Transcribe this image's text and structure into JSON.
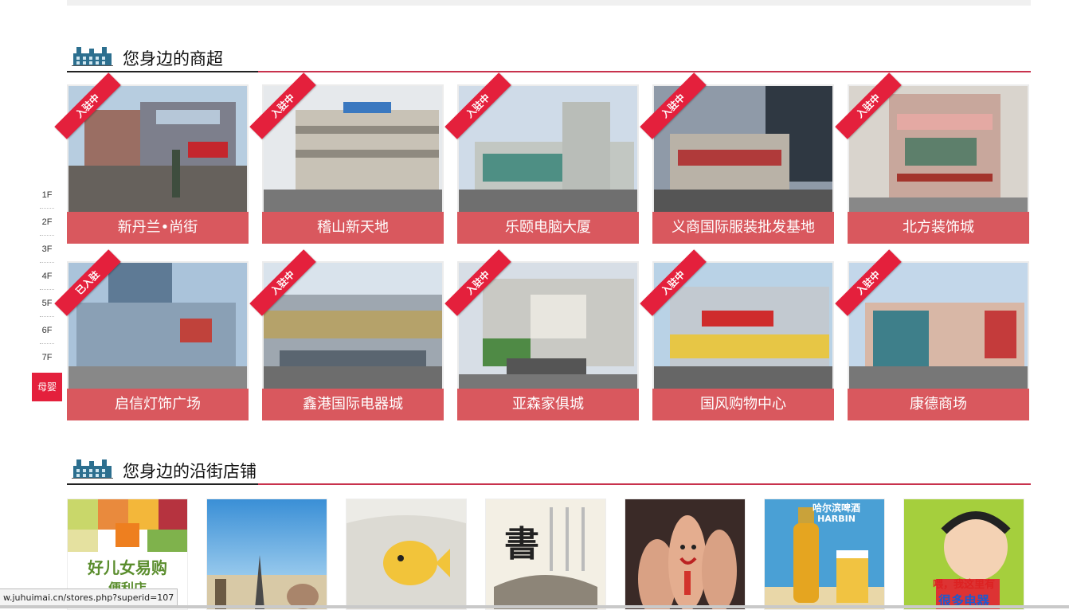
{
  "floor_nav": [
    "1F",
    "2F",
    "3F",
    "4F",
    "5F",
    "6F",
    "7F",
    "母婴"
  ],
  "malls_section": {
    "title": "您身边的商超"
  },
  "malls": [
    {
      "name": "新丹兰•尚街",
      "badge": "入驻中"
    },
    {
      "name": "稽山新天地",
      "badge": "入驻中"
    },
    {
      "name": "乐颐电脑大厦",
      "badge": "入驻中"
    },
    {
      "name": "义商国际服装批发基地",
      "badge": "入驻中"
    },
    {
      "name": "北方装饰城",
      "badge": "入驻中"
    },
    {
      "name": "启信灯饰广场",
      "badge": "已入驻"
    },
    {
      "name": "鑫港国际电器城",
      "badge": "入驻中"
    },
    {
      "name": "亚森家俱城",
      "badge": "入驻中"
    },
    {
      "name": "国风购物中心",
      "badge": "入驻中"
    },
    {
      "name": "康德商场",
      "badge": "入驻中"
    }
  ],
  "streets_section": {
    "title": "您身边的沿街店铺"
  },
  "stores": [
    {
      "text": "好儿女易购",
      "text2": "便利店"
    },
    {
      "text": ""
    },
    {
      "text": ""
    },
    {
      "text": "書"
    },
    {
      "text": ""
    },
    {
      "text": "HARBIN",
      "text2": "哈尔滨啤酒"
    },
    {
      "text": "喂，我这里有",
      "text2": "很多电器"
    }
  ],
  "status_url": "w.juhuimai.cn/stores.php?superid=107",
  "colors": {
    "accent": "#e4203c",
    "label_bg": "#d9585e",
    "section_line": "#c8324d"
  }
}
